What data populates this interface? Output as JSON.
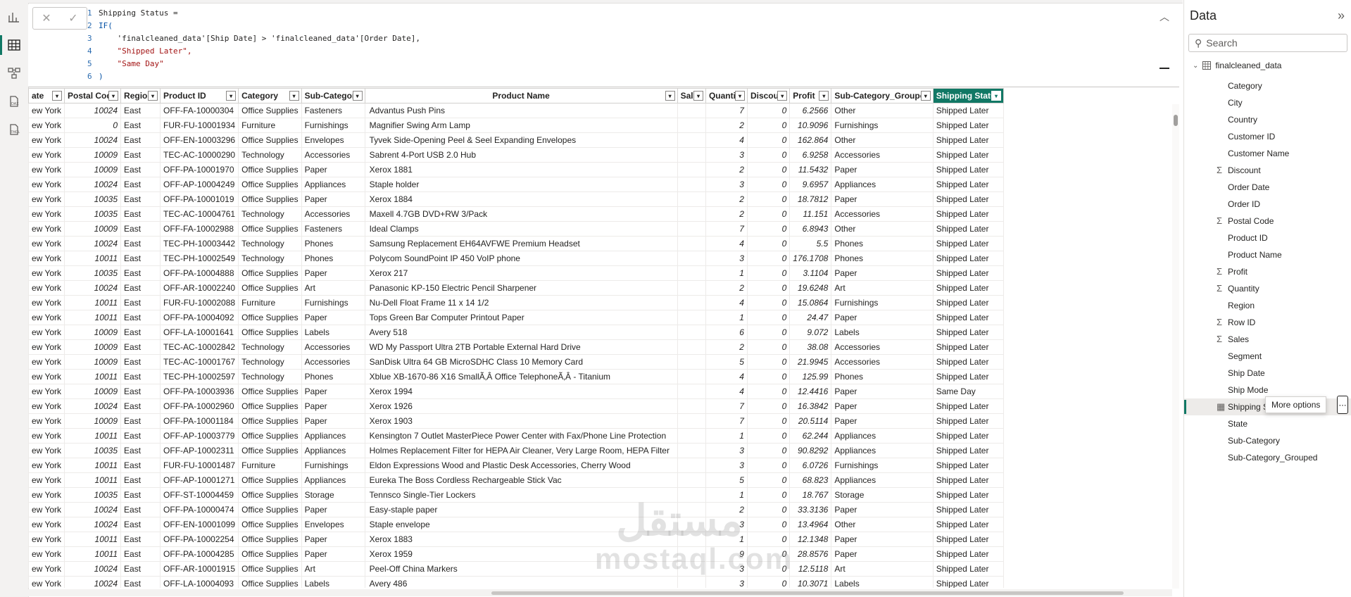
{
  "formula": {
    "lines": [
      {
        "n": "1",
        "t": "Shipping Status ="
      },
      {
        "n": "2",
        "t": "IF("
      },
      {
        "n": "3",
        "t": "    'finalcleaned_data'[Ship Date] > 'finalcleaned_data'[Order Date],"
      },
      {
        "n": "4",
        "t": "    \"Shipped Later\","
      },
      {
        "n": "5",
        "t": "    \"Same Day\""
      },
      {
        "n": "6",
        "t": ")"
      }
    ]
  },
  "table": {
    "columns": [
      "ate",
      "Postal Code",
      "Region",
      "Product ID",
      "Category",
      "Sub-Category",
      "Product Name",
      "Sales",
      "Quantity",
      "Discount",
      "Profit",
      "Sub-Category_Grouped",
      "Shipping Status"
    ],
    "rows": [
      [
        "ew York",
        "10024",
        "East",
        "OFF-FA-10000304",
        "Office Supplies",
        "Fasteners",
        "Advantus Push Pins",
        "",
        "7",
        "0",
        "6.2566",
        "Other",
        "Shipped Later"
      ],
      [
        "ew York",
        "0",
        "East",
        "FUR-FU-10001934",
        "Furniture",
        "Furnishings",
        "Magnifier Swing Arm Lamp",
        "",
        "2",
        "0",
        "10.9096",
        "Furnishings",
        "Shipped Later"
      ],
      [
        "ew York",
        "10024",
        "East",
        "OFF-EN-10003296",
        "Office Supplies",
        "Envelopes",
        "Tyvek Side-Opening Peel & Seel Expanding Envelopes",
        "",
        "4",
        "0",
        "162.864",
        "Other",
        "Shipped Later"
      ],
      [
        "ew York",
        "10009",
        "East",
        "TEC-AC-10000290",
        "Technology",
        "Accessories",
        "Sabrent 4-Port USB 2.0 Hub",
        "",
        "3",
        "0",
        "6.9258",
        "Accessories",
        "Shipped Later"
      ],
      [
        "ew York",
        "10009",
        "East",
        "OFF-PA-10001970",
        "Office Supplies",
        "Paper",
        "Xerox 1881",
        "",
        "2",
        "0",
        "11.5432",
        "Paper",
        "Shipped Later"
      ],
      [
        "ew York",
        "10024",
        "East",
        "OFF-AP-10004249",
        "Office Supplies",
        "Appliances",
        "Staple holder",
        "",
        "3",
        "0",
        "9.6957",
        "Appliances",
        "Shipped Later"
      ],
      [
        "ew York",
        "10035",
        "East",
        "OFF-PA-10001019",
        "Office Supplies",
        "Paper",
        "Xerox 1884",
        "",
        "2",
        "0",
        "18.7812",
        "Paper",
        "Shipped Later"
      ],
      [
        "ew York",
        "10035",
        "East",
        "TEC-AC-10004761",
        "Technology",
        "Accessories",
        "Maxell 4.7GB DVD+RW 3/Pack",
        "",
        "2",
        "0",
        "11.151",
        "Accessories",
        "Shipped Later"
      ],
      [
        "ew York",
        "10009",
        "East",
        "OFF-FA-10002988",
        "Office Supplies",
        "Fasteners",
        "Ideal Clamps",
        "",
        "7",
        "0",
        "6.8943",
        "Other",
        "Shipped Later"
      ],
      [
        "ew York",
        "10024",
        "East",
        "TEC-PH-10003442",
        "Technology",
        "Phones",
        "Samsung Replacement EH64AVFWE Premium Headset",
        "",
        "4",
        "0",
        "5.5",
        "Phones",
        "Shipped Later"
      ],
      [
        "ew York",
        "10011",
        "East",
        "TEC-PH-10002549",
        "Technology",
        "Phones",
        "Polycom SoundPoint IP 450 VoIP phone",
        "",
        "3",
        "0",
        "176.1708",
        "Phones",
        "Shipped Later"
      ],
      [
        "ew York",
        "10035",
        "East",
        "OFF-PA-10004888",
        "Office Supplies",
        "Paper",
        "Xerox 217",
        "",
        "1",
        "0",
        "3.1104",
        "Paper",
        "Shipped Later"
      ],
      [
        "ew York",
        "10024",
        "East",
        "OFF-AR-10002240",
        "Office Supplies",
        "Art",
        "Panasonic KP-150 Electric Pencil Sharpener",
        "",
        "2",
        "0",
        "19.6248",
        "Art",
        "Shipped Later"
      ],
      [
        "ew York",
        "10011",
        "East",
        "FUR-FU-10002088",
        "Furniture",
        "Furnishings",
        "Nu-Dell Float Frame 11 x 14 1/2",
        "",
        "4",
        "0",
        "15.0864",
        "Furnishings",
        "Shipped Later"
      ],
      [
        "ew York",
        "10011",
        "East",
        "OFF-PA-10004092",
        "Office Supplies",
        "Paper",
        "Tops Green Bar Computer Printout Paper",
        "",
        "1",
        "0",
        "24.47",
        "Paper",
        "Shipped Later"
      ],
      [
        "ew York",
        "10009",
        "East",
        "OFF-LA-10001641",
        "Office Supplies",
        "Labels",
        "Avery 518",
        "",
        "6",
        "0",
        "9.072",
        "Labels",
        "Shipped Later"
      ],
      [
        "ew York",
        "10009",
        "East",
        "TEC-AC-10002842",
        "Technology",
        "Accessories",
        "WD My Passport Ultra 2TB Portable External Hard Drive",
        "",
        "2",
        "0",
        "38.08",
        "Accessories",
        "Shipped Later"
      ],
      [
        "ew York",
        "10009",
        "East",
        "TEC-AC-10001767",
        "Technology",
        "Accessories",
        "SanDisk Ultra 64 GB MicroSDHC Class 10 Memory Card",
        "",
        "5",
        "0",
        "21.9945",
        "Accessories",
        "Shipped Later"
      ],
      [
        "ew York",
        "10011",
        "East",
        "TEC-PH-10002597",
        "Technology",
        "Phones",
        "Xblue XB-1670-86 X16 SmallÃ‚Â Office TelephoneÃ‚Â - Titanium",
        "",
        "4",
        "0",
        "125.99",
        "Phones",
        "Shipped Later"
      ],
      [
        "ew York",
        "10009",
        "East",
        "OFF-PA-10003936",
        "Office Supplies",
        "Paper",
        "Xerox 1994",
        "",
        "4",
        "0",
        "12.4416",
        "Paper",
        "Same Day"
      ],
      [
        "ew York",
        "10024",
        "East",
        "OFF-PA-10002960",
        "Office Supplies",
        "Paper",
        "Xerox 1926",
        "",
        "7",
        "0",
        "16.3842",
        "Paper",
        "Shipped Later"
      ],
      [
        "ew York",
        "10009",
        "East",
        "OFF-PA-10001184",
        "Office Supplies",
        "Paper",
        "Xerox 1903",
        "",
        "7",
        "0",
        "20.5114",
        "Paper",
        "Shipped Later"
      ],
      [
        "ew York",
        "10011",
        "East",
        "OFF-AP-10003779",
        "Office Supplies",
        "Appliances",
        "Kensington 7 Outlet MasterPiece Power Center with Fax/Phone Line Protection",
        "",
        "1",
        "0",
        "62.244",
        "Appliances",
        "Shipped Later"
      ],
      [
        "ew York",
        "10035",
        "East",
        "OFF-AP-10002311",
        "Office Supplies",
        "Appliances",
        "Holmes Replacement Filter for HEPA Air Cleaner, Very Large Room, HEPA Filter",
        "",
        "3",
        "0",
        "90.8292",
        "Appliances",
        "Shipped Later"
      ],
      [
        "ew York",
        "10011",
        "East",
        "FUR-FU-10001487",
        "Furniture",
        "Furnishings",
        "Eldon Expressions Wood and Plastic Desk Accessories, Cherry Wood",
        "",
        "3",
        "0",
        "6.0726",
        "Furnishings",
        "Shipped Later"
      ],
      [
        "ew York",
        "10011",
        "East",
        "OFF-AP-10001271",
        "Office Supplies",
        "Appliances",
        "Eureka The Boss Cordless Rechargeable Stick Vac",
        "",
        "5",
        "0",
        "68.823",
        "Appliances",
        "Shipped Later"
      ],
      [
        "ew York",
        "10035",
        "East",
        "OFF-ST-10004459",
        "Office Supplies",
        "Storage",
        "Tennsco Single-Tier Lockers",
        "",
        "1",
        "0",
        "18.767",
        "Storage",
        "Shipped Later"
      ],
      [
        "ew York",
        "10024",
        "East",
        "OFF-PA-10000474",
        "Office Supplies",
        "Paper",
        "Easy-staple paper",
        "",
        "2",
        "0",
        "33.3136",
        "Paper",
        "Shipped Later"
      ],
      [
        "ew York",
        "10024",
        "East",
        "OFF-EN-10001099",
        "Office Supplies",
        "Envelopes",
        "Staple envelope",
        "",
        "3",
        "0",
        "13.4964",
        "Other",
        "Shipped Later"
      ],
      [
        "ew York",
        "10011",
        "East",
        "OFF-PA-10002254",
        "Office Supplies",
        "Paper",
        "Xerox 1883",
        "",
        "1",
        "0",
        "12.1348",
        "Paper",
        "Shipped Later"
      ],
      [
        "ew York",
        "10011",
        "East",
        "OFF-PA-10004285",
        "Office Supplies",
        "Paper",
        "Xerox 1959",
        "",
        "9",
        "0",
        "28.8576",
        "Paper",
        "Shipped Later"
      ],
      [
        "ew York",
        "10024",
        "East",
        "OFF-AR-10001915",
        "Office Supplies",
        "Art",
        "Peel-Off China Markers",
        "",
        "3",
        "0",
        "12.5118",
        "Art",
        "Shipped Later"
      ],
      [
        "ew York",
        "10024",
        "East",
        "OFF-LA-10004093",
        "Office Supplies",
        "Labels",
        "Avery 486",
        "",
        "3",
        "0",
        "10.3071",
        "Labels",
        "Shipped Later"
      ]
    ]
  },
  "pane": {
    "title": "Data",
    "search_placeholder": "Search",
    "table_name": "finalcleaned_data",
    "fields": [
      {
        "label": "Category",
        "sigma": false
      },
      {
        "label": "City",
        "sigma": false
      },
      {
        "label": "Country",
        "sigma": false
      },
      {
        "label": "Customer ID",
        "sigma": false
      },
      {
        "label": "Customer Name",
        "sigma": false
      },
      {
        "label": "Discount",
        "sigma": true
      },
      {
        "label": "Order Date",
        "sigma": false
      },
      {
        "label": "Order ID",
        "sigma": false
      },
      {
        "label": "Postal Code",
        "sigma": true
      },
      {
        "label": "Product ID",
        "sigma": false
      },
      {
        "label": "Product Name",
        "sigma": false
      },
      {
        "label": "Profit",
        "sigma": true
      },
      {
        "label": "Quantity",
        "sigma": true
      },
      {
        "label": "Region",
        "sigma": false
      },
      {
        "label": "Row ID",
        "sigma": true
      },
      {
        "label": "Sales",
        "sigma": true
      },
      {
        "label": "Segment",
        "sigma": false
      },
      {
        "label": "Ship Date",
        "sigma": false
      },
      {
        "label": "Ship Mode",
        "sigma": false
      },
      {
        "label": "Shipping S",
        "sigma": false,
        "calc": true,
        "active": true
      },
      {
        "label": "State",
        "sigma": false
      },
      {
        "label": "Sub-Category",
        "sigma": false
      },
      {
        "label": "Sub-Category_Grouped",
        "sigma": false
      }
    ],
    "tooltip": "More options"
  },
  "watermark": {
    "arabic": "مستقل",
    "latin": "mostaql.com"
  }
}
